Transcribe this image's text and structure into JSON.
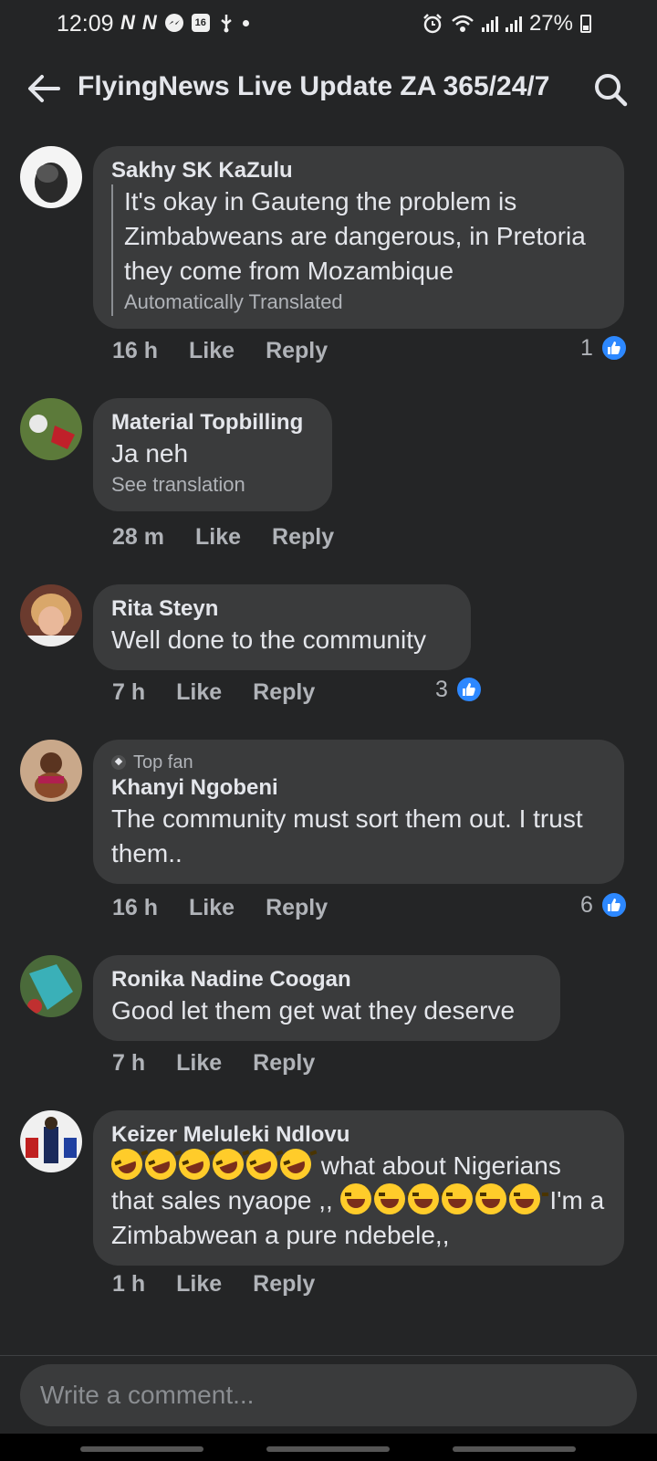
{
  "status_bar": {
    "time": "12:09",
    "notifications": [
      "N",
      "N",
      "messenger",
      "16",
      "usb",
      "dot"
    ],
    "calendar_day": "16",
    "battery": "27%"
  },
  "header": {
    "title": "FlyingNews Live Update ZA 365/24/7"
  },
  "comments": [
    {
      "author": "Sakhy SK KaZulu",
      "text": "It's okay in Gauteng the problem is Zimbabweans are dangerous, in Pretoria they come from Mozambique",
      "translation_note": "Automatically Translated",
      "time": "16 h",
      "like_label": "Like",
      "reply_label": "Reply",
      "reactions": "1"
    },
    {
      "author": "Material Topbilling",
      "text": "Ja neh",
      "translation_note": "See translation",
      "time": "28 m",
      "like_label": "Like",
      "reply_label": "Reply"
    },
    {
      "author": "Rita Steyn",
      "text": "Well done to the community",
      "time": "7 h",
      "like_label": "Like",
      "reply_label": "Reply",
      "reactions": "3"
    },
    {
      "badge": "Top fan",
      "author": "Khanyi Ngobeni",
      "text": "The community must sort them out. I trust them..",
      "time": "16 h",
      "like_label": "Like",
      "reply_label": "Reply",
      "reactions": "6"
    },
    {
      "author": "Ronika Nadine Coogan",
      "text": "Good let them get wat they deserve",
      "time": "7 h",
      "like_label": "Like",
      "reply_label": "Reply"
    },
    {
      "author": "Keizer Meluleki Ndlovu",
      "text_part1": " what  about Nigerians that  sales nyaope ,, ",
      "text_part2": " I'm a Zimbabwean a pure ndebele,,",
      "time": "1 h",
      "like_label": "Like",
      "reply_label": "Reply"
    }
  ],
  "composer": {
    "placeholder": "Write a comment..."
  },
  "colors": {
    "background": "#242526",
    "bubble": "#3a3b3c",
    "like_blue": "#2d88ff"
  }
}
